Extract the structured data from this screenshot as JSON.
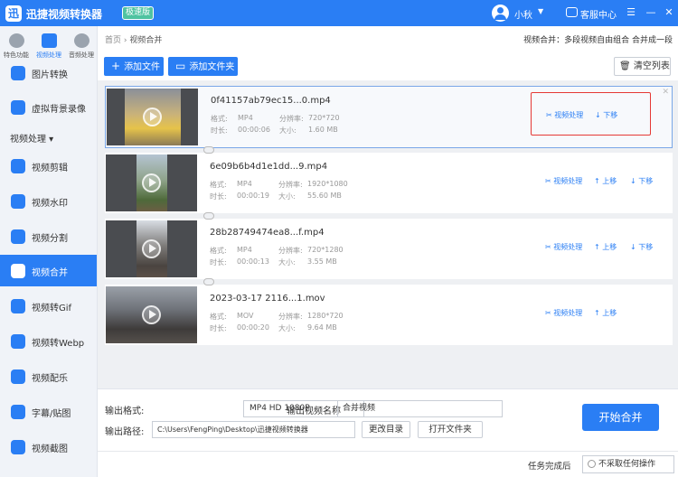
{
  "app": {
    "title": "迅捷视频转换器",
    "badge": "极速版",
    "user": "小秋",
    "service": "客服中心"
  },
  "sidebar": {
    "top_tabs": [
      {
        "label": "特色功能"
      },
      {
        "label": "视频处理"
      },
      {
        "label": "音频处理"
      }
    ],
    "items_before": [
      {
        "label": "图片转换"
      },
      {
        "label": "虚拟背景录像"
      }
    ],
    "section": "视频处理",
    "items": [
      {
        "label": "视频剪辑"
      },
      {
        "label": "视频水印"
      },
      {
        "label": "视频分割"
      },
      {
        "label": "视频合并"
      },
      {
        "label": "视频转Gif"
      },
      {
        "label": "视频转Webp"
      },
      {
        "label": "视频配乐"
      },
      {
        "label": "字幕/贴图"
      },
      {
        "label": "视频截图"
      }
    ]
  },
  "breadcrumb": {
    "home": "首页",
    "current": "视频合并"
  },
  "hint": "视频合并：多段视频自由组合 合并成一段",
  "toolbar": {
    "add_file": "添加文件",
    "add_folder": "添加文件夹",
    "clear": "清空列表"
  },
  "labels": {
    "format": "格式:",
    "resolution": "分辨率:",
    "duration": "时长:",
    "size": "大小:",
    "process": "视频处理",
    "up": "上移",
    "down": "下移"
  },
  "files": [
    {
      "name": "0f41157ab79ec15...0.mp4",
      "format": "MP4",
      "resolution": "720*720",
      "duration": "00:00:06",
      "size": "1.60 MB"
    },
    {
      "name": "6e09b6b4d1e1dd...9.mp4",
      "format": "MP4",
      "resolution": "1920*1080",
      "duration": "00:00:19",
      "size": "55.60 MB"
    },
    {
      "name": "28b28749474ea8...f.mp4",
      "format": "MP4",
      "resolution": "720*1280",
      "duration": "00:00:13",
      "size": "3.55 MB"
    },
    {
      "name": "2023-03-17 2116...1.mov",
      "format": "MOV",
      "resolution": "1280*720",
      "duration": "00:00:20",
      "size": "9.64 MB"
    }
  ],
  "output": {
    "format_label": "输出格式:",
    "format_value": "MP4  HD 1080P",
    "name_label": "输出视频名称",
    "name_value": "合并视频",
    "path_label": "输出路径:",
    "path_value": "C:\\Users\\FengPing\\Desktop\\迅捷视频转换器",
    "change_dir": "更改目录",
    "open_folder": "打开文件夹",
    "start": "开始合并"
  },
  "footer": {
    "label": "任务完成后",
    "option": "不采取任何操作"
  },
  "colors": {
    "brand": "#2a7ef4",
    "highlight": "#e53935"
  }
}
